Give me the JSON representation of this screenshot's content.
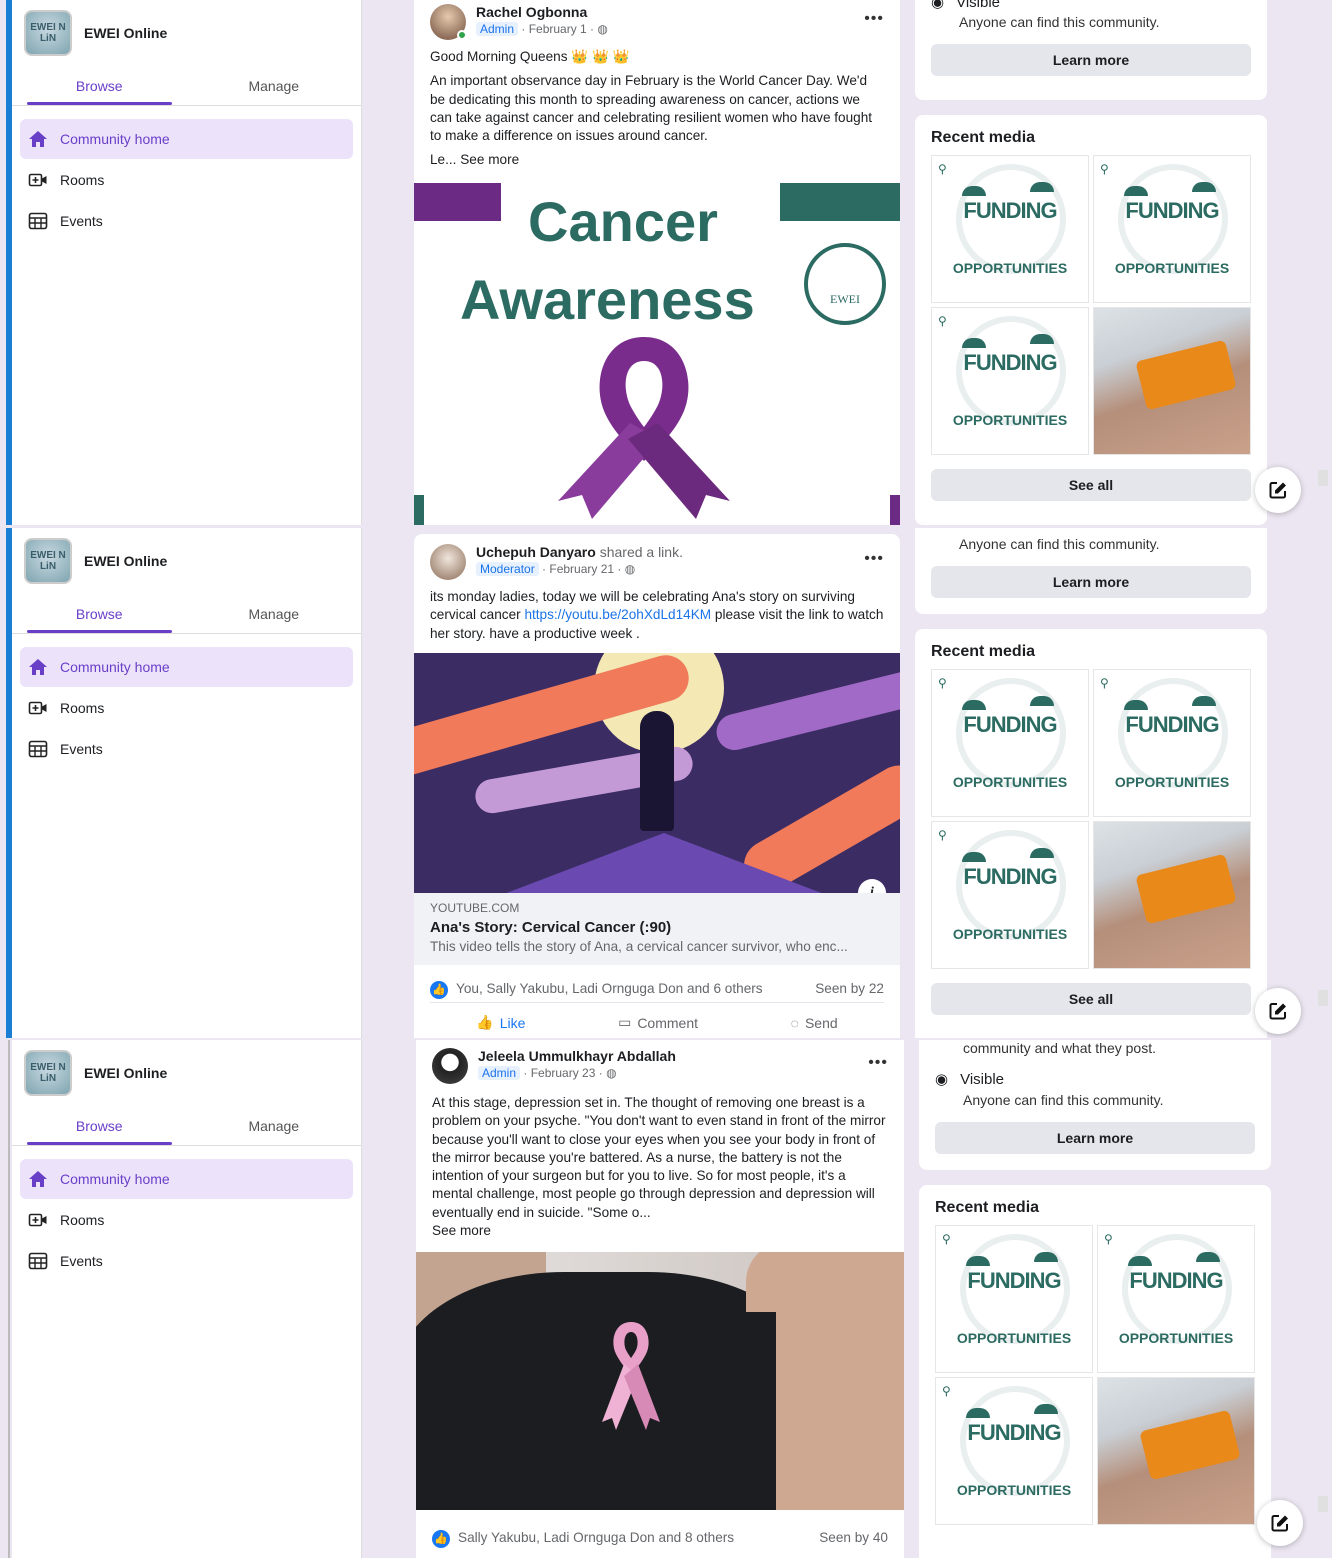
{
  "community": {
    "name": "EWEI Online",
    "logo_text": "EWEI N LiN"
  },
  "sidebar": {
    "tabs": [
      {
        "label": "Browse"
      },
      {
        "label": "Manage"
      }
    ],
    "items": [
      {
        "label": "Community home"
      },
      {
        "label": "Rooms"
      },
      {
        "label": "Events"
      }
    ]
  },
  "posts": [
    {
      "author": "Rachel Ogbonna",
      "role": "Admin",
      "date": "February 1",
      "greeting": "Good Morning Queens 👑 👑 👑",
      "text": "An important observance day in February is the World Cancer Day. We'd be dedicating this month to spreading awareness on cancer, actions we can take against cancer and celebrating resilient women who have fought to make a difference on issues around cancer.",
      "truncated": "Le...",
      "see_more": "See more",
      "image": {
        "title_1": "Cancer",
        "title_2": "Awareness",
        "seal_text": "EWEI"
      }
    },
    {
      "author": "Uchepuh Danyaro",
      "action": "shared a link.",
      "role": "Moderator",
      "date": "February 21",
      "text_before": "its monday ladies, today we will be celebrating Ana's story on surviving cervical cancer ",
      "link": "https://youtu.be/2ohXdLd14KM",
      "text_after": " please visit the link to watch her story. have a productive week .",
      "link_preview": {
        "domain": "YOUTUBE.COM",
        "title": "Ana's Story: Cervical Cancer (:90)",
        "description": "This video tells the story of Ana, a cervical cancer survivor, who enc..."
      },
      "reactions": "You, Sally Yakubu, Ladi Ornguga Don and 6 others",
      "seen": "Seen by 22",
      "actions": {
        "like": "Like",
        "comment": "Comment",
        "send": "Send"
      }
    },
    {
      "author": "Jeleela Ummulkhayr Abdallah",
      "role": "Admin",
      "date": "February 23",
      "text": "At this stage, depression set in. The thought of removing one breast is a problem on your psyche.  \"You don't want to even stand in front of the mirror because you'll want to close your eyes when you see your body in front of the mirror because you're battered. As a nurse, the battery is not the intention of your surgeon but for you to live. So for most people, it's a mental challenge, most people go through depression and depression will eventually end in suicide.  \"Some o...",
      "see_more": "See more",
      "reactions": "Sally Yakubu, Ladi Ornguga Don and 8 others",
      "seen": "Seen by 40"
    }
  ],
  "about": {
    "visible_label": "Visible",
    "visible_desc": "Anyone can find this community.",
    "privacy_tail": "community and what they post.",
    "learn_more": "Learn more"
  },
  "recent_media": {
    "title": "Recent media",
    "see_all": "See all",
    "tile_line_1": "FUNDING",
    "tile_line_2": "OPPORTUNITIES"
  },
  "colors": {
    "accent": "#6a3fc8",
    "link": "#1a73e8",
    "awareness_green": "#2c6b62",
    "ribbon_purple": "#7a2c8c"
  }
}
